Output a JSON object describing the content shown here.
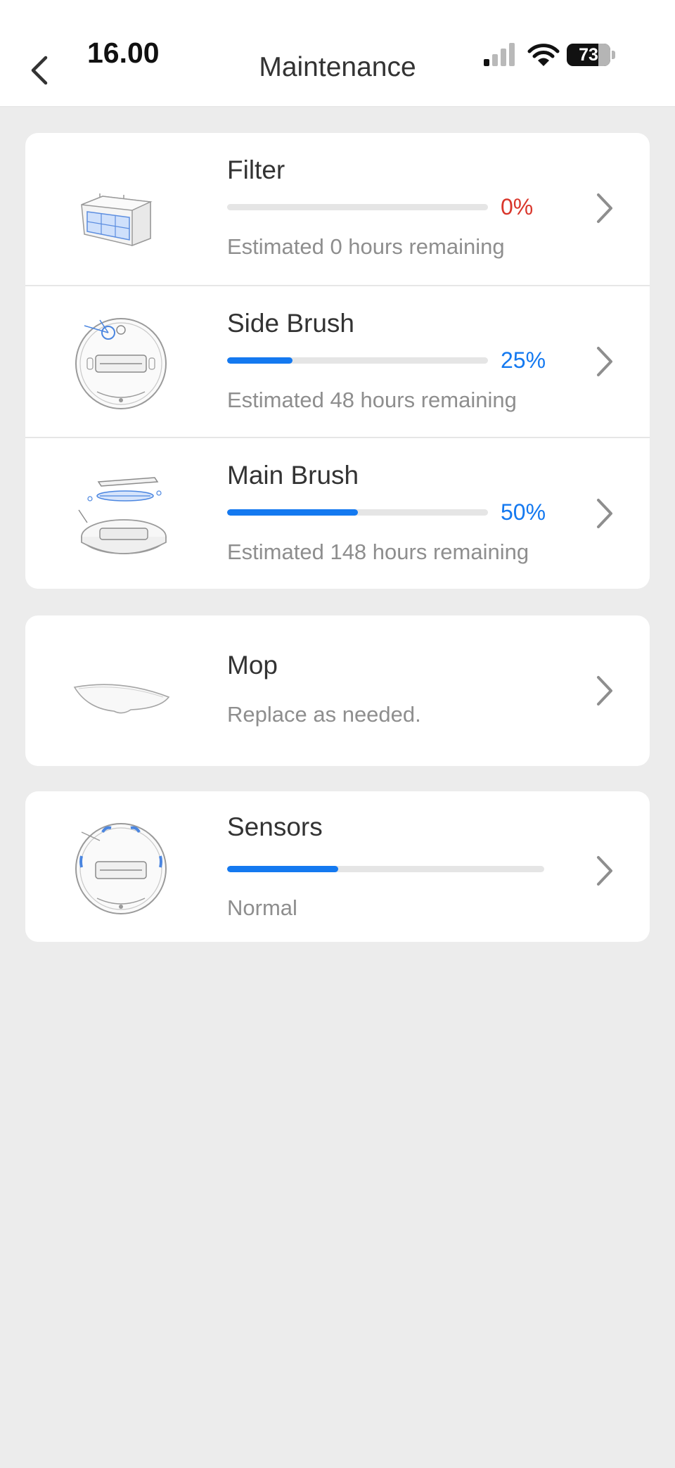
{
  "status_bar": {
    "time": "16.00",
    "battery": "73"
  },
  "header": {
    "title": "Maintenance"
  },
  "items": [
    {
      "name": "Filter",
      "percent_label": "0%",
      "level": 0,
      "note": "Estimated 0 hours remaining"
    },
    {
      "name": "Side Brush",
      "percent_label": "25%",
      "level": 0.25,
      "note": "Estimated 48 hours remaining"
    },
    {
      "name": "Main Brush",
      "percent_label": "50%",
      "level": 0.5,
      "note": "Estimated 148 hours remaining"
    },
    {
      "name": "Mop",
      "note": "Replace as needed."
    },
    {
      "name": "Sensors",
      "level": 0.35,
      "note": "Normal"
    }
  ],
  "colors": {
    "accent": "#1479f0",
    "alert": "#d9362b",
    "track": "#e5e5e5",
    "background": "#ececec"
  }
}
